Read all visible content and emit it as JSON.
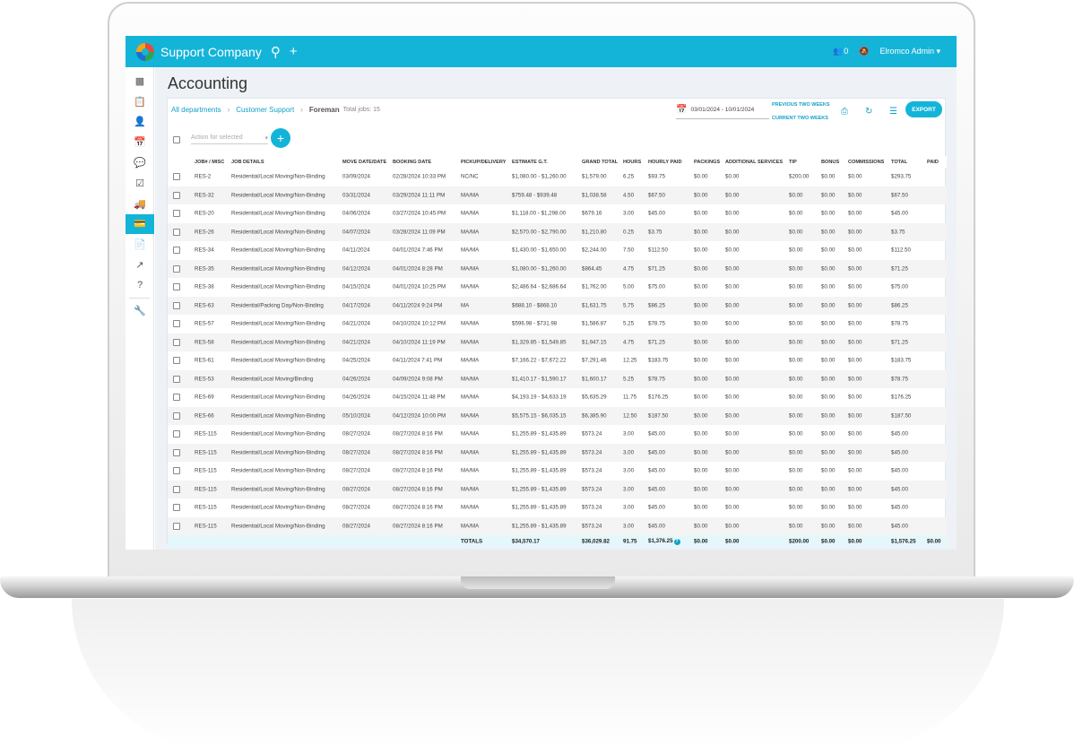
{
  "header": {
    "company": "Support Company",
    "notifications_count": "0",
    "user": "Elromco Admin"
  },
  "page": {
    "title": "Accounting",
    "breadcrumbs": [
      "All departments",
      "Customer Support",
      "Foreman"
    ],
    "total_jobs": "Total jobs: 15",
    "date_range": "03/01/2024 - 10/01/2024",
    "previous_weeks": "PREVIOUS TWO WEEKS",
    "current_weeks": "CURRENT TWO WEEKS",
    "export_label": "EXPORT",
    "action_placeholder": "Action for selected"
  },
  "table": {
    "columns": [
      "JOB# / MISC",
      "JOB DETAILS",
      "MOVE DATE/DATE",
      "BOOKING DATE",
      "PICKUP/DELIVERY",
      "ESTIMATE G.T.",
      "GRAND TOTAL",
      "HOURS",
      "HOURLY PAID",
      "PACKINGS",
      "ADDITIONAL SERVICES",
      "TIP",
      "BONUS",
      "COMMISSIONS",
      "TOTAL",
      "PAID"
    ],
    "rows": [
      [
        "RES-2",
        "Residential/Local Moving/Non-Binding",
        "03/09/2024",
        "02/28/2024 10:33 PM",
        "NC/NC",
        "$1,080.00 - $1,260.00",
        "$1,579.00",
        "6.25",
        "$93.75",
        "$0.00",
        "$0.00",
        "$200.00",
        "$0.00",
        "$0.00",
        "$293.75",
        ""
      ],
      [
        "RES-32",
        "Residential/Local Moving/Non-Binding",
        "03/31/2024",
        "03/29/2024 11:11 PM",
        "MA/MA",
        "$759.48 - $939.48",
        "$1,038.58",
        "4.50",
        "$67.50",
        "$0.00",
        "$0.00",
        "$0.00",
        "$0.00",
        "$0.00",
        "$67.50",
        ""
      ],
      [
        "RES-20",
        "Residential/Local Moving/Non-Binding",
        "04/06/2024",
        "03/27/2024 10:45 PM",
        "MA/MA",
        "$1,118.00 - $1,298.00",
        "$679.16",
        "3.00",
        "$45.00",
        "$0.00",
        "$0.00",
        "$0.00",
        "$0.00",
        "$0.00",
        "$45.00",
        ""
      ],
      [
        "RES-26",
        "Residential/Local Moving/Non-Binding",
        "04/07/2024",
        "03/28/2024 11:09 PM",
        "MA/MA",
        "$2,570.00 - $2,790.00",
        "$1,210.80",
        "0.25",
        "$3.75",
        "$0.00",
        "$0.00",
        "$0.00",
        "$0.00",
        "$0.00",
        "$3.75",
        ""
      ],
      [
        "RES-34",
        "Residential/Local Moving/Non-Binding",
        "04/11/2024",
        "04/01/2024 7:46 PM",
        "MA/MA",
        "$1,430.00 - $1,650.00",
        "$2,244.00",
        "7.50",
        "$112.50",
        "$0.00",
        "$0.00",
        "$0.00",
        "$0.00",
        "$0.00",
        "$112.50",
        ""
      ],
      [
        "RES-35",
        "Residential/Local Moving/Non-Binding",
        "04/12/2024",
        "04/01/2024 8:28 PM",
        "MA/MA",
        "$1,080.00 - $1,260.00",
        "$864.45",
        "4.75",
        "$71.25",
        "$0.00",
        "$0.00",
        "$0.00",
        "$0.00",
        "$0.00",
        "$71.25",
        ""
      ],
      [
        "RES-38",
        "Residential/Local Moving/Non-Binding",
        "04/15/2024",
        "04/01/2024 10:25 PM",
        "MA/MA",
        "$2,486.64 - $2,686.64",
        "$1,762.00",
        "5.00",
        "$75.00",
        "$0.00",
        "$0.00",
        "$0.00",
        "$0.00",
        "$0.00",
        "$75.00",
        ""
      ],
      [
        "RES-63",
        "Residential/Packing Day/Non-Binding",
        "04/17/2024",
        "04/11/2024 9:24 PM",
        "MA",
        "$688.10 - $868.10",
        "$1,631.75",
        "5.75",
        "$86.25",
        "$0.00",
        "$0.00",
        "$0.00",
        "$0.00",
        "$0.00",
        "$86.25",
        ""
      ],
      [
        "RES-57",
        "Residential/Local Moving/Non-Binding",
        "04/21/2024",
        "04/10/2024 10:12 PM",
        "MA/MA",
        "$596.98 - $731.98",
        "$1,586.87",
        "5.25",
        "$78.75",
        "$0.00",
        "$0.00",
        "$0.00",
        "$0.00",
        "$0.00",
        "$78.75",
        ""
      ],
      [
        "RES-58",
        "Residential/Local Moving/Non-Binding",
        "04/21/2024",
        "04/10/2024 11:19 PM",
        "MA/MA",
        "$1,329.85 - $1,549.85",
        "$1,947.15",
        "4.75",
        "$71.25",
        "$0.00",
        "$0.00",
        "$0.00",
        "$0.00",
        "$0.00",
        "$71.25",
        ""
      ],
      [
        "RES-61",
        "Residential/Local Moving/Non-Binding",
        "04/25/2024",
        "04/11/2024 7:41 PM",
        "MA/MA",
        "$7,166.22 - $7,672.22",
        "$7,291.46",
        "12.25",
        "$183.75",
        "$0.00",
        "$0.00",
        "$0.00",
        "$0.00",
        "$0.00",
        "$183.75",
        ""
      ],
      [
        "RES-53",
        "Residential/Local Moving/Binding",
        "04/26/2024",
        "04/09/2024 9:08 PM",
        "MA/MA",
        "$1,410.17 - $1,590.17",
        "$1,600.17",
        "5.25",
        "$78.75",
        "$0.00",
        "$0.00",
        "$0.00",
        "$0.00",
        "$0.00",
        "$78.75",
        ""
      ],
      [
        "RES-69",
        "Residential/Local Moving/Non-Binding",
        "04/26/2024",
        "04/15/2024 11:48 PM",
        "MA/MA",
        "$4,193.19 - $4,633.19",
        "$5,635.29",
        "11.75",
        "$176.25",
        "$0.00",
        "$0.00",
        "$0.00",
        "$0.00",
        "$0.00",
        "$176.25",
        ""
      ],
      [
        "RES-66",
        "Residential/Local Moving/Non-Binding",
        "05/10/2024",
        "04/12/2024 10:00 PM",
        "MA/MA",
        "$5,575.15 - $6,035.15",
        "$6,385.90",
        "12.50",
        "$187.50",
        "$0.00",
        "$0.00",
        "$0.00",
        "$0.00",
        "$0.00",
        "$187.50",
        ""
      ],
      [
        "RES-115",
        "Residential/Local Moving/Non-Binding",
        "08/27/2024",
        "08/27/2024 8:16 PM",
        "MA/MA",
        "$1,255.89 - $1,435.89",
        "$573.24",
        "3.00",
        "$45.00",
        "$0.00",
        "$0.00",
        "$0.00",
        "$0.00",
        "$0.00",
        "$45.00",
        ""
      ],
      [
        "RES-115",
        "Residential/Local Moving/Non-Binding",
        "08/27/2024",
        "08/27/2024 8:16 PM",
        "MA/MA",
        "$1,255.89 - $1,435.89",
        "$573.24",
        "3.00",
        "$45.00",
        "$0.00",
        "$0.00",
        "$0.00",
        "$0.00",
        "$0.00",
        "$45.00",
        ""
      ],
      [
        "RES-115",
        "Residential/Local Moving/Non-Binding",
        "08/27/2024",
        "08/27/2024 8:16 PM",
        "MA/MA",
        "$1,255.89 - $1,435.89",
        "$573.24",
        "3.00",
        "$45.00",
        "$0.00",
        "$0.00",
        "$0.00",
        "$0.00",
        "$0.00",
        "$45.00",
        ""
      ],
      [
        "RES-115",
        "Residential/Local Moving/Non-Binding",
        "08/27/2024",
        "08/27/2024 8:16 PM",
        "MA/MA",
        "$1,255.89 - $1,435.89",
        "$573.24",
        "3.00",
        "$45.00",
        "$0.00",
        "$0.00",
        "$0.00",
        "$0.00",
        "$0.00",
        "$45.00",
        ""
      ],
      [
        "RES-115",
        "Residential/Local Moving/Non-Binding",
        "08/27/2024",
        "08/27/2024 8:16 PM",
        "MA/MA",
        "$1,255.89 - $1,435.89",
        "$573.24",
        "3.00",
        "$45.00",
        "$0.00",
        "$0.00",
        "$0.00",
        "$0.00",
        "$0.00",
        "$45.00",
        ""
      ],
      [
        "RES-115",
        "Residential/Local Moving/Non-Binding",
        "08/27/2024",
        "08/27/2024 8:16 PM",
        "MA/MA",
        "$1,255.89 - $1,435.89",
        "$573.24",
        "3.00",
        "$45.00",
        "$0.00",
        "$0.00",
        "$0.00",
        "$0.00",
        "$0.00",
        "$45.00",
        ""
      ]
    ],
    "totals": {
      "label": "TOTALS",
      "estimate": "$34,570.17",
      "grand_total": "$36,029.82",
      "hours": "91.75",
      "hourly_paid": "$1,376.25",
      "packings": "$0.00",
      "additional": "$0.00",
      "tip": "$200.00",
      "bonus": "$0.00",
      "commissions": "$0.00",
      "total": "$1,576.25",
      "paid": "$0.00"
    }
  },
  "sidebar": {
    "icons": [
      "reports-icon",
      "clipboard-icon",
      "contacts-icon",
      "calendar-icon",
      "chat-icon",
      "tasks-icon",
      "truck-icon",
      "accounting-icon",
      "document-icon",
      "trend-icon",
      "help-icon",
      "settings-wrench-icon"
    ],
    "active": "accounting-icon"
  },
  "colors": {
    "accent": "#14b4d9",
    "link": "#14a0c8"
  }
}
